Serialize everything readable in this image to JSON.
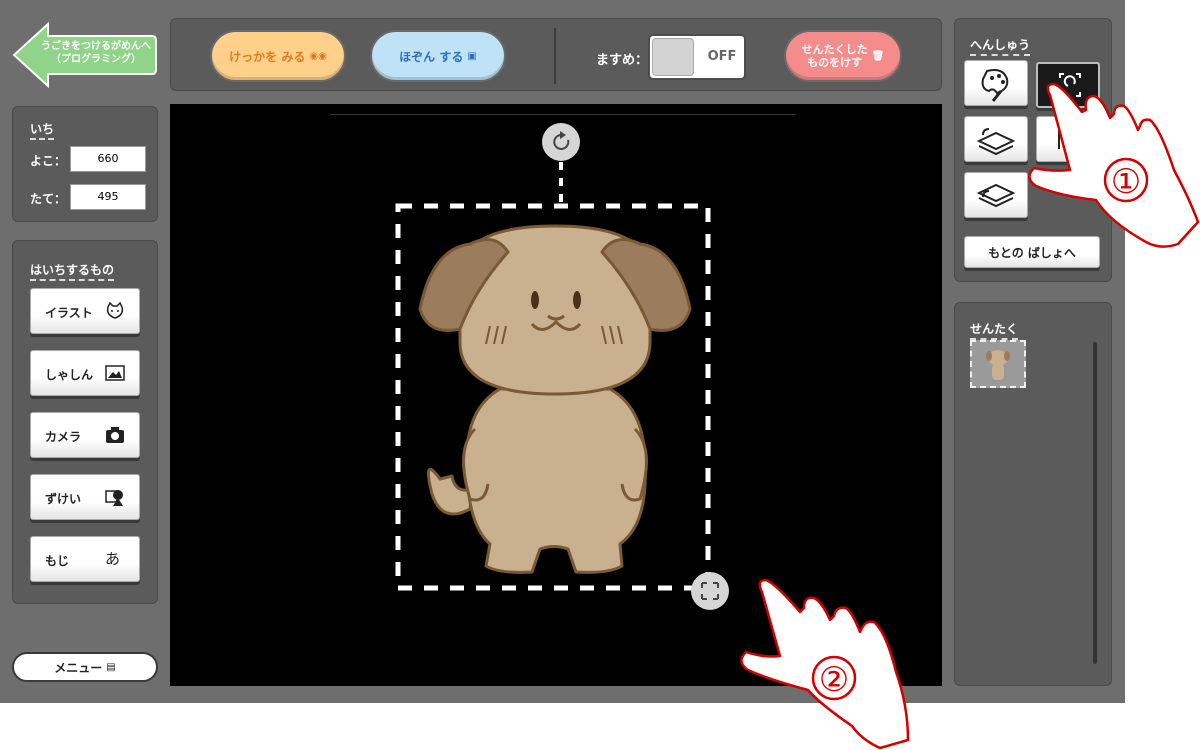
{
  "header": {
    "back_label_line1": "うごきをつけるがめんへ",
    "back_label_line2": "（プログラミング）",
    "result_label": "けっかを みる",
    "save_label": "ほぞん する",
    "grid_label": "ますめ：",
    "grid_toggle_state": "OFF",
    "delete_label_line1": "せんたくした",
    "delete_label_line2": "ものをけす"
  },
  "position": {
    "title": "いち",
    "x_label": "よこ：",
    "x_value": "660",
    "y_label": "たて：",
    "y_value": "495"
  },
  "place": {
    "title": "はいちするもの",
    "items": [
      {
        "label": "イラスト",
        "icon": "cat-face-icon"
      },
      {
        "label": "しゃしん",
        "icon": "photo-icon"
      },
      {
        "label": "カメラ",
        "icon": "camera-icon"
      },
      {
        "label": "ずけい",
        "icon": "shapes-icon"
      },
      {
        "label": "もじ",
        "icon": "text-a-icon"
      }
    ]
  },
  "menu": {
    "label": "メニュー"
  },
  "edit": {
    "title": "へんしゅう",
    "reset_label": "もとの ばしょへ"
  },
  "selection": {
    "title": "せんたく"
  },
  "annotations": {
    "step1": "①",
    "step2": "②"
  },
  "colors": {
    "back_green": "#8fd488",
    "result_orange": "#ffd08a",
    "save_blue": "#bfe2f7",
    "delete_red": "#f48c8c",
    "dog_body": "#c9b08f",
    "dog_ear": "#9b7c5c",
    "dog_outline": "#7a5a34"
  }
}
